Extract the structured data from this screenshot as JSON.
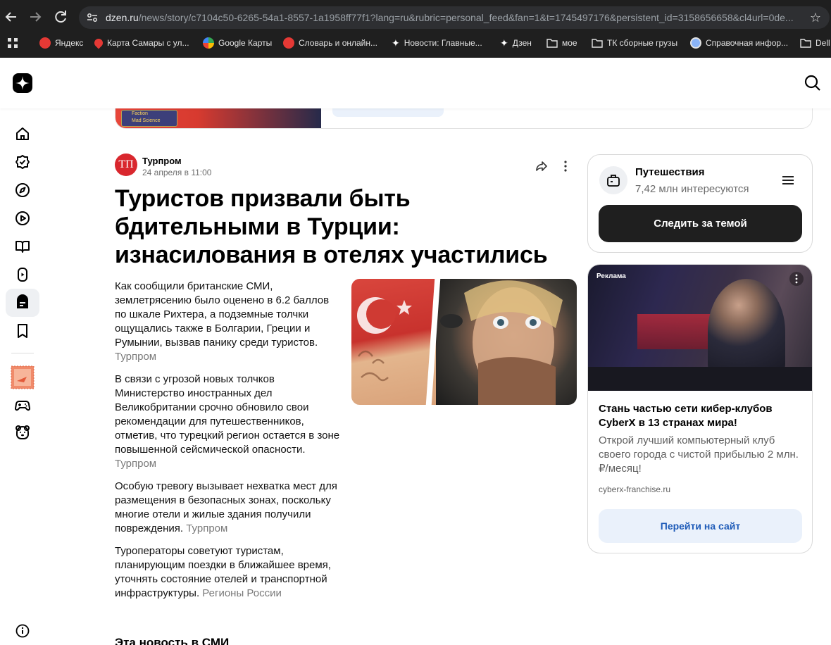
{
  "browser": {
    "url_host": "dzen.ru",
    "url_path": "/news/story/c7104c50-6265-54a1-8557-1a1958ff77f1?lang=ru&rubric=personal_feed&fan=1&t=1745497176&persistent_id=3158656658&cl4url=0de...",
    "bookmarks": [
      {
        "label": "Яндекс",
        "icon": "yandex-icon",
        "color": "#e53935"
      },
      {
        "label": "Карта Самары с ул...",
        "icon": "map-pin-icon",
        "color": "#e53935"
      },
      {
        "label": "Google Карты",
        "icon": "google-maps-icon",
        "color": "#34a853"
      },
      {
        "label": "Словарь и онлайн...",
        "icon": "dictionary-icon",
        "color": "#e53935"
      },
      {
        "label": "Новости: Главные...",
        "icon": "dzen-star-icon",
        "color": "#ffffff"
      },
      {
        "label": "Дзен",
        "icon": "dzen-star-icon",
        "color": "#ffffff"
      },
      {
        "label": "мое",
        "icon": "folder-icon",
        "color": "#e3e3e3"
      },
      {
        "label": "ТК сборные грузы",
        "icon": "folder-icon",
        "color": "#e3e3e3"
      },
      {
        "label": "Справочная инфор...",
        "icon": "globe-icon",
        "color": "#8ab4f8"
      },
      {
        "label": "Dell",
        "icon": "folder-icon",
        "color": "#e3e3e3"
      }
    ]
  },
  "top_strip": {
    "badge_line1": "Faction",
    "badge_line2": "Mad Science"
  },
  "article": {
    "author": "Турпром",
    "author_avatar_text": "ТП",
    "date": "24 апреля в 11:00",
    "title": "Туристов призвали быть бдительными в Турции: изнасилования в отелях участились",
    "paragraphs": [
      {
        "text": "Как сообщили британские СМИ, землетрясению было оценено в 6.2 баллов по шкале Рихтера, а подземные толчки ощущались также в Болгарии, Греции и Румынии, вызвав панику среди туристов.",
        "source": "Турпром"
      },
      {
        "text": "В связи с угрозой новых толчков Министерство иностранных дел Великобритании срочно обновило свои рекомендации для путешественников, отметив, что турецкий регион остается в зоне повышенной сейсмической опасности.",
        "source": "Турпром"
      },
      {
        "text": "Особую тревогу вызывает нехватка мест для размещения в безопасных зонах, поскольку многие отели и жилые здания получили повреждения.",
        "source": "Турпром"
      },
      {
        "text": "Туроператоры советуют туристам, планирующим поездки в ближайшее время, уточнять состояние отелей и транспортной инфраструктуры.",
        "source": "Регионы России"
      }
    ],
    "next_section_title": "Эта новость в СМИ"
  },
  "topic": {
    "name": "Путешествия",
    "followers": "7,42 млн интересуются",
    "follow_label": "Следить за темой"
  },
  "ad": {
    "label": "Реклама",
    "title": "Стань частью сети кибер-клубов CyberX в 13 странах мира!",
    "description": "Открой лучший компьютерный клуб своего города с чистой прибылью 2 млн.₽/месяц!",
    "domain": "cyberx-franchise.ru",
    "cta_label": "Перейти на сайт",
    "cta_color": "#1e5bb8"
  },
  "colors": {
    "chrome_bg": "#1f1f1f",
    "follow_bg": "#1f1f1f",
    "active_rail_bg": "#eef0f3"
  }
}
